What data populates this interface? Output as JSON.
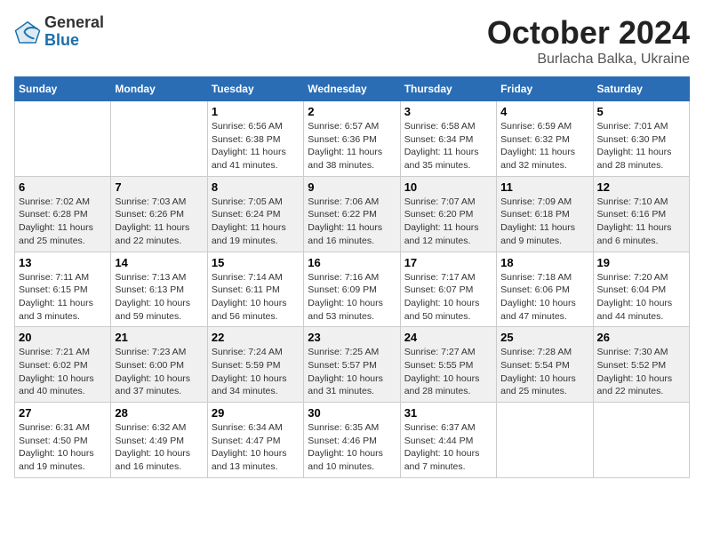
{
  "logo": {
    "general": "General",
    "blue": "Blue"
  },
  "title": "October 2024",
  "subtitle": "Burlacha Balka, Ukraine",
  "days_header": [
    "Sunday",
    "Monday",
    "Tuesday",
    "Wednesday",
    "Thursday",
    "Friday",
    "Saturday"
  ],
  "weeks": [
    [
      {
        "day": "",
        "info": ""
      },
      {
        "day": "",
        "info": ""
      },
      {
        "day": "1",
        "info": "Sunrise: 6:56 AM\nSunset: 6:38 PM\nDaylight: 11 hours and 41 minutes."
      },
      {
        "day": "2",
        "info": "Sunrise: 6:57 AM\nSunset: 6:36 PM\nDaylight: 11 hours and 38 minutes."
      },
      {
        "day": "3",
        "info": "Sunrise: 6:58 AM\nSunset: 6:34 PM\nDaylight: 11 hours and 35 minutes."
      },
      {
        "day": "4",
        "info": "Sunrise: 6:59 AM\nSunset: 6:32 PM\nDaylight: 11 hours and 32 minutes."
      },
      {
        "day": "5",
        "info": "Sunrise: 7:01 AM\nSunset: 6:30 PM\nDaylight: 11 hours and 28 minutes."
      }
    ],
    [
      {
        "day": "6",
        "info": "Sunrise: 7:02 AM\nSunset: 6:28 PM\nDaylight: 11 hours and 25 minutes."
      },
      {
        "day": "7",
        "info": "Sunrise: 7:03 AM\nSunset: 6:26 PM\nDaylight: 11 hours and 22 minutes."
      },
      {
        "day": "8",
        "info": "Sunrise: 7:05 AM\nSunset: 6:24 PM\nDaylight: 11 hours and 19 minutes."
      },
      {
        "day": "9",
        "info": "Sunrise: 7:06 AM\nSunset: 6:22 PM\nDaylight: 11 hours and 16 minutes."
      },
      {
        "day": "10",
        "info": "Sunrise: 7:07 AM\nSunset: 6:20 PM\nDaylight: 11 hours and 12 minutes."
      },
      {
        "day": "11",
        "info": "Sunrise: 7:09 AM\nSunset: 6:18 PM\nDaylight: 11 hours and 9 minutes."
      },
      {
        "day": "12",
        "info": "Sunrise: 7:10 AM\nSunset: 6:16 PM\nDaylight: 11 hours and 6 minutes."
      }
    ],
    [
      {
        "day": "13",
        "info": "Sunrise: 7:11 AM\nSunset: 6:15 PM\nDaylight: 11 hours and 3 minutes."
      },
      {
        "day": "14",
        "info": "Sunrise: 7:13 AM\nSunset: 6:13 PM\nDaylight: 10 hours and 59 minutes."
      },
      {
        "day": "15",
        "info": "Sunrise: 7:14 AM\nSunset: 6:11 PM\nDaylight: 10 hours and 56 minutes."
      },
      {
        "day": "16",
        "info": "Sunrise: 7:16 AM\nSunset: 6:09 PM\nDaylight: 10 hours and 53 minutes."
      },
      {
        "day": "17",
        "info": "Sunrise: 7:17 AM\nSunset: 6:07 PM\nDaylight: 10 hours and 50 minutes."
      },
      {
        "day": "18",
        "info": "Sunrise: 7:18 AM\nSunset: 6:06 PM\nDaylight: 10 hours and 47 minutes."
      },
      {
        "day": "19",
        "info": "Sunrise: 7:20 AM\nSunset: 6:04 PM\nDaylight: 10 hours and 44 minutes."
      }
    ],
    [
      {
        "day": "20",
        "info": "Sunrise: 7:21 AM\nSunset: 6:02 PM\nDaylight: 10 hours and 40 minutes."
      },
      {
        "day": "21",
        "info": "Sunrise: 7:23 AM\nSunset: 6:00 PM\nDaylight: 10 hours and 37 minutes."
      },
      {
        "day": "22",
        "info": "Sunrise: 7:24 AM\nSunset: 5:59 PM\nDaylight: 10 hours and 34 minutes."
      },
      {
        "day": "23",
        "info": "Sunrise: 7:25 AM\nSunset: 5:57 PM\nDaylight: 10 hours and 31 minutes."
      },
      {
        "day": "24",
        "info": "Sunrise: 7:27 AM\nSunset: 5:55 PM\nDaylight: 10 hours and 28 minutes."
      },
      {
        "day": "25",
        "info": "Sunrise: 7:28 AM\nSunset: 5:54 PM\nDaylight: 10 hours and 25 minutes."
      },
      {
        "day": "26",
        "info": "Sunrise: 7:30 AM\nSunset: 5:52 PM\nDaylight: 10 hours and 22 minutes."
      }
    ],
    [
      {
        "day": "27",
        "info": "Sunrise: 6:31 AM\nSunset: 4:50 PM\nDaylight: 10 hours and 19 minutes."
      },
      {
        "day": "28",
        "info": "Sunrise: 6:32 AM\nSunset: 4:49 PM\nDaylight: 10 hours and 16 minutes."
      },
      {
        "day": "29",
        "info": "Sunrise: 6:34 AM\nSunset: 4:47 PM\nDaylight: 10 hours and 13 minutes."
      },
      {
        "day": "30",
        "info": "Sunrise: 6:35 AM\nSunset: 4:46 PM\nDaylight: 10 hours and 10 minutes."
      },
      {
        "day": "31",
        "info": "Sunrise: 6:37 AM\nSunset: 4:44 PM\nDaylight: 10 hours and 7 minutes."
      },
      {
        "day": "",
        "info": ""
      },
      {
        "day": "",
        "info": ""
      }
    ]
  ]
}
